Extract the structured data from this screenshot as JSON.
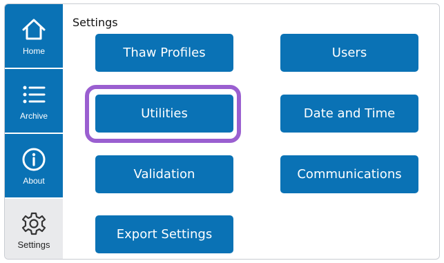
{
  "sidebar": {
    "items": [
      {
        "label": "Home",
        "icon": "home-icon"
      },
      {
        "label": "Archive",
        "icon": "list-icon"
      },
      {
        "label": "About",
        "icon": "info-icon"
      },
      {
        "label": "Settings",
        "icon": "gear-icon",
        "active": true
      }
    ]
  },
  "main": {
    "title": "Settings",
    "buttons": {
      "thaw_profiles": "Thaw Profiles",
      "users": "Users",
      "utilities": "Utilities",
      "date_and_time": "Date and Time",
      "validation": "Validation",
      "communications": "Communications",
      "export_settings": "Export Settings"
    }
  },
  "colors": {
    "accent": "#0a72b5",
    "highlight": "#9a5fd0",
    "sidebar_active_bg": "#e9eaec"
  }
}
